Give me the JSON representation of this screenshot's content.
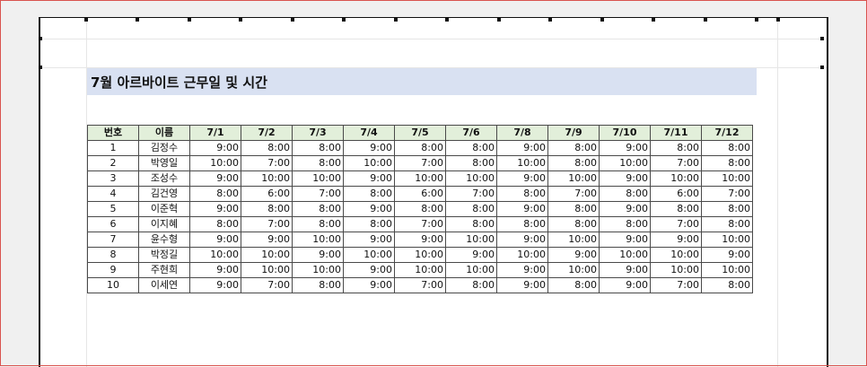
{
  "sheet": {
    "title": "7월 아르바이트 근무일 및 시간",
    "headers": [
      "번호",
      "이름",
      "7/1",
      "7/2",
      "7/3",
      "7/4",
      "7/5",
      "7/6",
      "7/8",
      "7/9",
      "7/10",
      "7/11",
      "7/12"
    ],
    "rows": [
      [
        "1",
        "김정수",
        "9:00",
        "8:00",
        "8:00",
        "9:00",
        "8:00",
        "8:00",
        "9:00",
        "8:00",
        "9:00",
        "8:00",
        "8:00"
      ],
      [
        "2",
        "박영일",
        "10:00",
        "7:00",
        "8:00",
        "10:00",
        "7:00",
        "8:00",
        "10:00",
        "8:00",
        "10:00",
        "7:00",
        "8:00"
      ],
      [
        "3",
        "조성수",
        "9:00",
        "10:00",
        "10:00",
        "9:00",
        "10:00",
        "10:00",
        "9:00",
        "10:00",
        "9:00",
        "10:00",
        "10:00"
      ],
      [
        "4",
        "김건영",
        "8:00",
        "6:00",
        "7:00",
        "8:00",
        "6:00",
        "7:00",
        "8:00",
        "7:00",
        "8:00",
        "6:00",
        "7:00"
      ],
      [
        "5",
        "이준혁",
        "9:00",
        "8:00",
        "8:00",
        "9:00",
        "8:00",
        "8:00",
        "9:00",
        "8:00",
        "9:00",
        "8:00",
        "8:00"
      ],
      [
        "6",
        "이지혜",
        "8:00",
        "7:00",
        "8:00",
        "8:00",
        "7:00",
        "8:00",
        "8:00",
        "8:00",
        "8:00",
        "7:00",
        "8:00"
      ],
      [
        "7",
        "윤수형",
        "9:00",
        "9:00",
        "10:00",
        "9:00",
        "9:00",
        "10:00",
        "9:00",
        "10:00",
        "9:00",
        "9:00",
        "10:00"
      ],
      [
        "8",
        "박정길",
        "10:00",
        "10:00",
        "9:00",
        "10:00",
        "10:00",
        "9:00",
        "10:00",
        "9:00",
        "10:00",
        "10:00",
        "9:00"
      ],
      [
        "9",
        "주현희",
        "9:00",
        "10:00",
        "10:00",
        "9:00",
        "10:00",
        "10:00",
        "9:00",
        "10:00",
        "9:00",
        "10:00",
        "10:00"
      ],
      [
        "10",
        "이세연",
        "9:00",
        "7:00",
        "8:00",
        "9:00",
        "7:00",
        "8:00",
        "9:00",
        "8:00",
        "9:00",
        "7:00",
        "8:00"
      ]
    ]
  },
  "colors": {
    "title_band": "#d9e1f2",
    "header_fill": "#e2efda",
    "grid_line": "#4a4a4a",
    "workspace_bg": "#f0f0f0",
    "page_bg": "#ffffff"
  }
}
